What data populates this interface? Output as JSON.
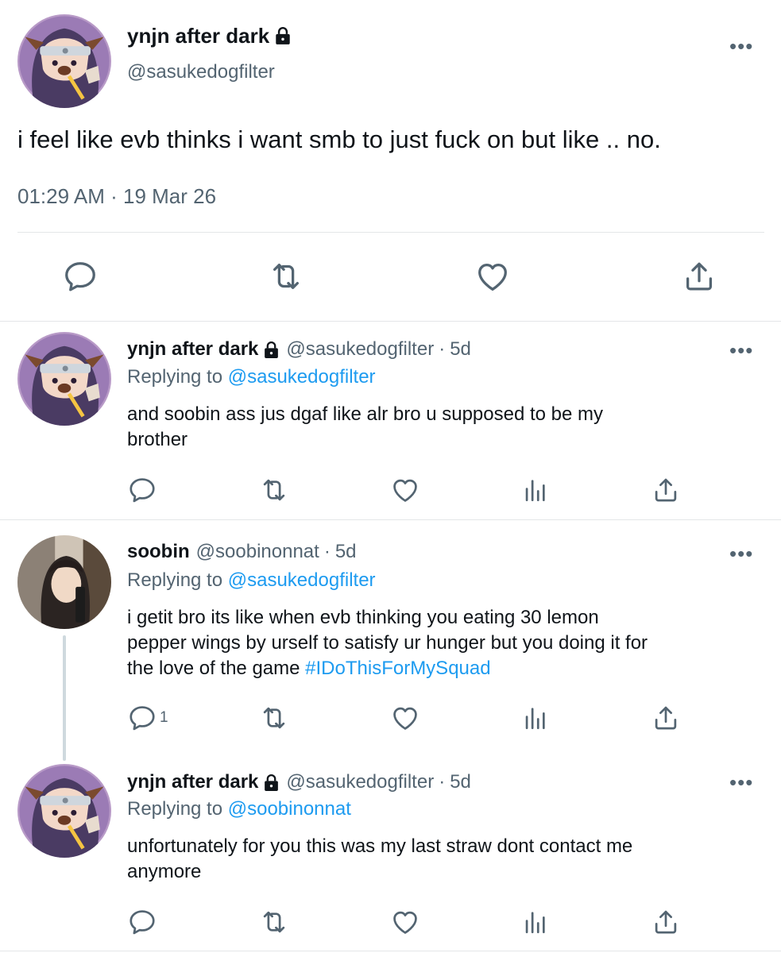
{
  "main_tweet": {
    "display_name": "ynjn after dark",
    "handle": "@sasukedogfilter",
    "text": "i feel like evb thinks i want smb to just fuck on but like .. no.",
    "time": "01:29 AM",
    "sep": "·",
    "date": "19 Mar 26",
    "more": "•••",
    "icons": [
      "reply-icon",
      "retweet-icon",
      "like-icon",
      "share-icon"
    ]
  },
  "replies": [
    {
      "display_name": "ynjn after dark",
      "handle": "@sasukedogfilter",
      "sep": "·",
      "time_ago": "5d",
      "replying_prefix": "Replying to",
      "replying_to": "@sasukedogfilter",
      "text_line1": "and soobin ass jus dgaf like alr bro u supposed to be my",
      "text_line2": "brother",
      "more": "•••"
    },
    {
      "display_name": "soobin",
      "handle": "@soobinonnat",
      "sep": "·",
      "time_ago": "5d",
      "replying_prefix": "Replying to",
      "replying_to": "@sasukedogfilter",
      "text_line1": "i getit bro its like when evb thinking you eating 30 lemon",
      "text_line2": "pepper wings by urself to satisfy ur hunger but you doing it for",
      "text_line3": "the love of the game",
      "hashtag": "#IDoThisForMySquad",
      "reply_count": "1",
      "more": "•••"
    },
    {
      "display_name": "ynjn after dark",
      "handle": "@sasukedogfilter",
      "sep": "·",
      "time_ago": "5d",
      "replying_prefix": "Replying to",
      "replying_to": "@soobinonnat",
      "text_line1": "unfortunately for you this was my last straw dont contact me",
      "text_line2": "anymore",
      "more": "•••"
    }
  ],
  "colors": {
    "accent": "#1d9bf0",
    "text": "#0f1419",
    "muted": "#536471",
    "divider": "#e4e6e8"
  }
}
